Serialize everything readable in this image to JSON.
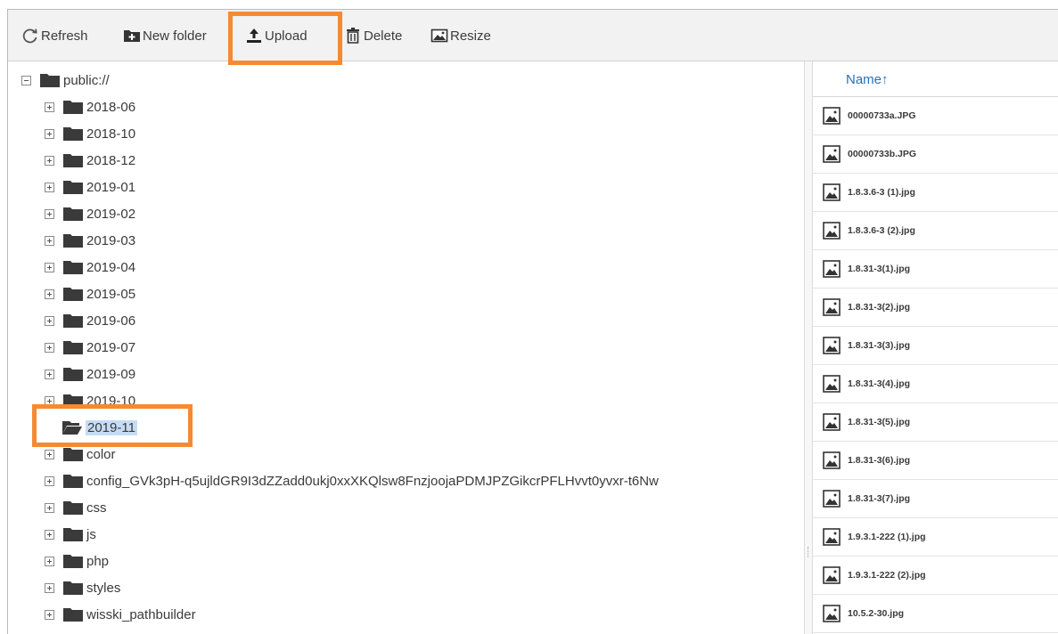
{
  "toolbar": {
    "refresh": "Refresh",
    "new_folder": "New folder",
    "upload": "Upload",
    "delete": "Delete",
    "resize": "Resize"
  },
  "tree": {
    "root": "public://",
    "folders": [
      {
        "label": "2018-06",
        "state": "collapsed"
      },
      {
        "label": "2018-10",
        "state": "collapsed"
      },
      {
        "label": "2018-12",
        "state": "collapsed"
      },
      {
        "label": "2019-01",
        "state": "collapsed"
      },
      {
        "label": "2019-02",
        "state": "collapsed"
      },
      {
        "label": "2019-03",
        "state": "collapsed"
      },
      {
        "label": "2019-04",
        "state": "collapsed"
      },
      {
        "label": "2019-05",
        "state": "collapsed"
      },
      {
        "label": "2019-06",
        "state": "collapsed"
      },
      {
        "label": "2019-07",
        "state": "collapsed"
      },
      {
        "label": "2019-09",
        "state": "collapsed"
      },
      {
        "label": "2019-10",
        "state": "collapsed"
      },
      {
        "label": "2019-11",
        "state": "selected"
      },
      {
        "label": "color",
        "state": "collapsed"
      },
      {
        "label": "config_GVk3pH-q5ujldGR9I3dZZadd0ukj0xxXKQlsw8FnzjoojaPDMJPZGikcrPFLHvvt0yvxr-t6Nw",
        "state": "collapsed"
      },
      {
        "label": "css",
        "state": "collapsed"
      },
      {
        "label": "js",
        "state": "collapsed"
      },
      {
        "label": "php",
        "state": "collapsed"
      },
      {
        "label": "styles",
        "state": "collapsed"
      },
      {
        "label": "wisski_pathbuilder",
        "state": "collapsed"
      }
    ]
  },
  "files": {
    "column_name": "Name↑",
    "items": [
      "00000733a.JPG",
      "00000733b.JPG",
      "1.8.3.6-3 (1).jpg",
      "1.8.3.6-3 (2).jpg",
      "1.8.31-3(1).jpg",
      "1.8.31-3(2).jpg",
      "1.8.31-3(3).jpg",
      "1.8.31-3(4).jpg",
      "1.8.31-3(5).jpg",
      "1.8.31-3(6).jpg",
      "1.8.31-3(7).jpg",
      "1.9.3.1-222 (1).jpg",
      "1.9.3.1-222 (2).jpg",
      "10.5.2-30.jpg"
    ]
  },
  "colors": {
    "highlight": "#f58a33",
    "selection": "#c6dcf5",
    "folder": "#3a3a3a",
    "header_link": "#2a6ebb"
  }
}
